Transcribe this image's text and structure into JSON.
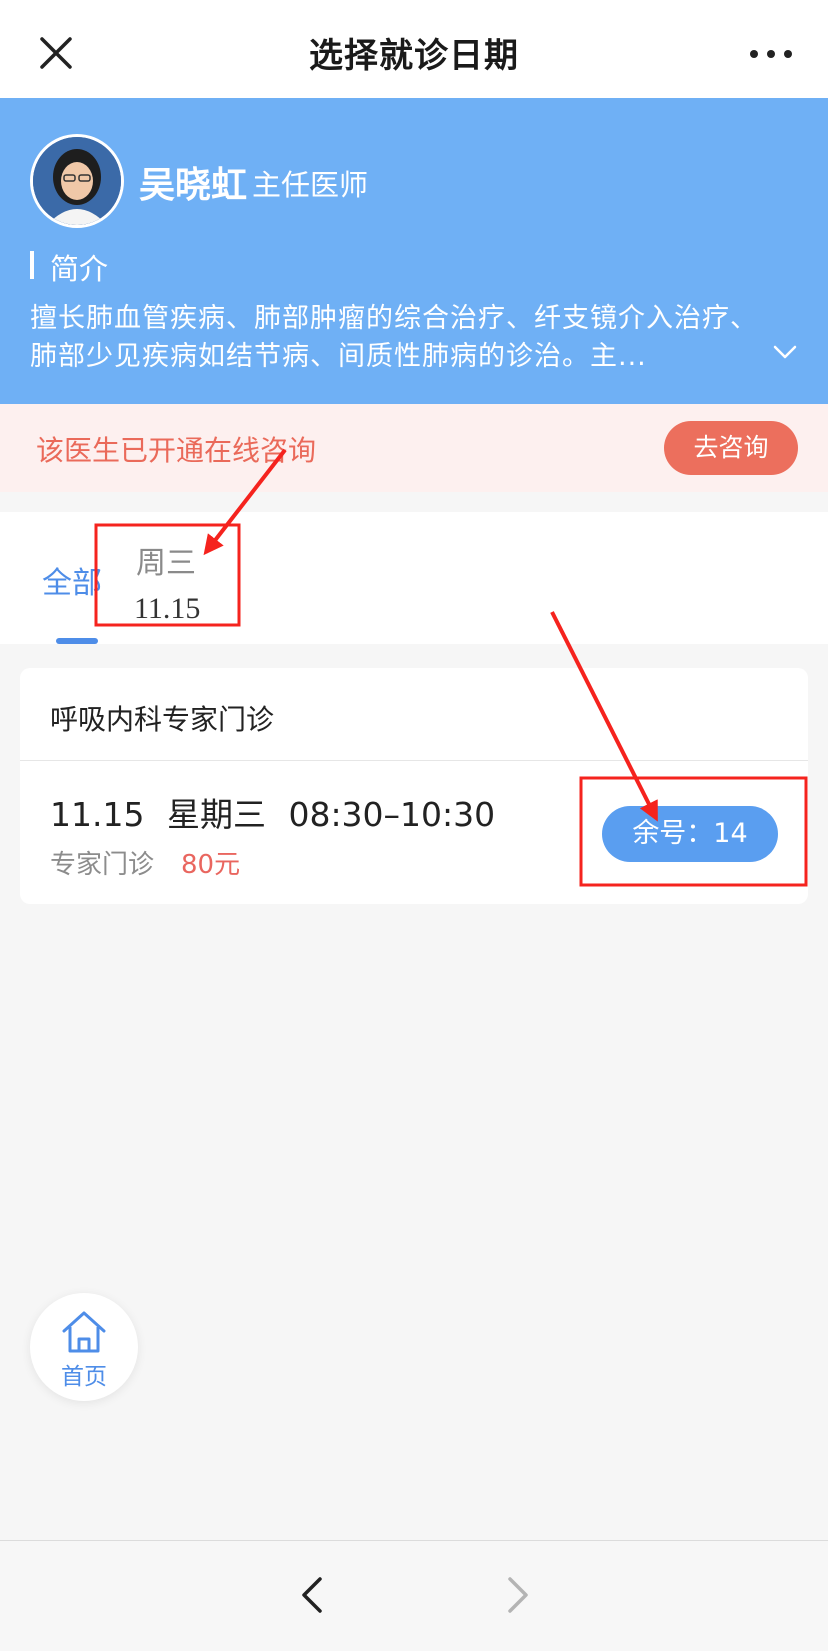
{
  "nav": {
    "title": "选择就诊日期",
    "close_icon": "close-icon",
    "more_icon": "more-icon"
  },
  "doctor": {
    "name": "吴晓虹",
    "title": "主任医师",
    "intro_label": "简介",
    "intro_text": "擅长肺血管疾病、肺部肿瘤的综合治疗、纤支镜介入治疗、肺部少见疾病如结节病、间质性肺病的诊治。主...",
    "expand_icon": "chevron-down-icon"
  },
  "consult": {
    "message": "该医生已开通在线咨询",
    "button_label": "去咨询"
  },
  "tabs": {
    "all_label": "全部",
    "days": [
      {
        "weekday": "周三",
        "date": "11.15"
      }
    ]
  },
  "schedule": {
    "department": "呼吸内科专家门诊",
    "slot": {
      "time": "11.15 星期三 08:30–10:30",
      "type": "专家门诊",
      "price": "80元",
      "remain_label": "余号：14"
    }
  },
  "home": {
    "label": "首页",
    "icon": "home-icon"
  },
  "bottom_bar": {
    "back_icon": "chevron-left-icon",
    "forward_icon": "chevron-right-icon"
  },
  "colors": {
    "header_blue": "#6fb0f5",
    "accent_blue": "#4e8de8",
    "consult_red": "#ec6f5d",
    "price_red": "#e9665f",
    "annotation_red": "#f5231e"
  }
}
